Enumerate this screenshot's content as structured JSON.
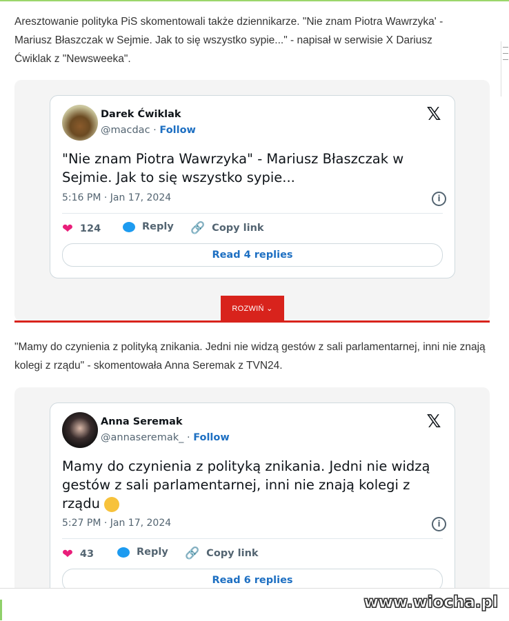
{
  "article": {
    "para1": "Aresztowanie polityka PiS skomentowali także dziennikarze. \"Nie znam Piotra Wawrzyka' - Mariusz Błaszczak w Sejmie. Jak to się wszystko sypie...\" - napisał w serwisie X Dariusz Ćwiklak z \"Newsweeka\".",
    "para2": "\"Mamy do czynienia z polityką znikania. Jedni nie widzą gestów z sali parlamentarnej, inni nie znają kolegi z rządu\" - skomentowała Anna Seremak z TVN24.",
    "expand_label": "ROZWIŃ"
  },
  "tweets": [
    {
      "name": "Darek Ćwiklak",
      "handle": "@macdac",
      "follow": "Follow",
      "body": "\"Nie znam Piotra Wawrzyka\" - Mariusz Błaszczak w Sejmie. Jak to się wszystko sypie...",
      "time": "5:16 PM · Jan 17, 2024",
      "likes": "124",
      "reply": "Reply",
      "copy": "Copy link",
      "read": "Read 4 replies"
    },
    {
      "name": "Anna Seremak",
      "handle": "@annaseremak_",
      "follow": "Follow",
      "body": "Mamy do czynienia z polityką znikania. Jedni nie widzą gestów z sali parlamentarnej, inni nie znają kolegi z rządu",
      "time": "5:27 PM · Jan 17, 2024",
      "likes": "43",
      "reply": "Reply",
      "copy": "Copy link",
      "read": "Read 6 replies"
    }
  ],
  "watermark": "www.wiocha.pl",
  "colors": {
    "accent_red": "#d8231c",
    "link_blue": "#1d6fc2",
    "heart": "#e91e7a"
  },
  "icons": [
    "x-logo-icon",
    "heart-icon",
    "reply-bubble-icon",
    "link-icon",
    "info-icon",
    "chevron-down-icon",
    "thinking-face-emoji"
  ]
}
